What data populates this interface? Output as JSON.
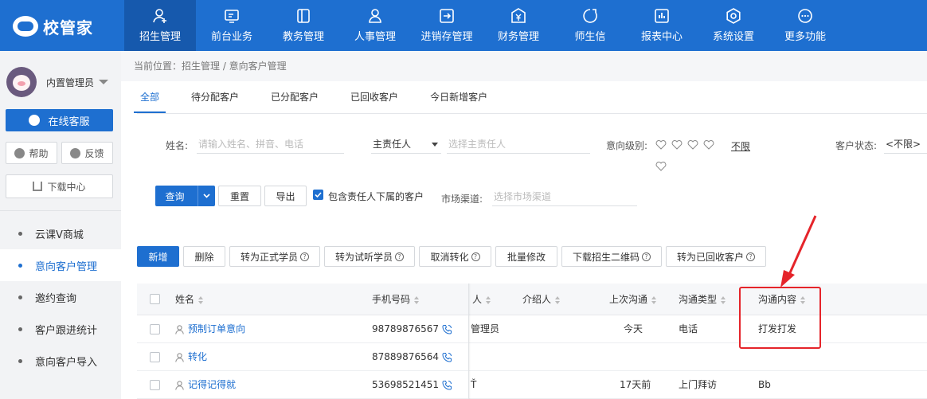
{
  "app": {
    "logo_text": "校管家"
  },
  "nav": [
    {
      "label": "招生管理",
      "icon": "user-add-icon"
    },
    {
      "label": "前台业务",
      "icon": "monitor-icon"
    },
    {
      "label": "教务管理",
      "icon": "book-icon"
    },
    {
      "label": "人事管理",
      "icon": "person-icon"
    },
    {
      "label": "进销存管理",
      "icon": "inventory-icon"
    },
    {
      "label": "财务管理",
      "icon": "yen-icon"
    },
    {
      "label": "师生信",
      "icon": "chat-icon"
    },
    {
      "label": "报表中心",
      "icon": "chart-icon"
    },
    {
      "label": "系统设置",
      "icon": "settings-icon"
    },
    {
      "label": "更多功能",
      "icon": "more-icon"
    }
  ],
  "sidebar": {
    "username": "内置管理员",
    "online_service": "在线客服",
    "help": "帮助",
    "feedback": "反馈",
    "download_center": "下载中心",
    "menu": [
      {
        "label": "云课V商城"
      },
      {
        "label": "意向客户管理"
      },
      {
        "label": "邀约查询"
      },
      {
        "label": "客户跟进统计"
      },
      {
        "label": "意向客户导入"
      }
    ]
  },
  "breadcrumb": "当前位置：招生管理 / 意向客户管理",
  "tabs": [
    "全部",
    "待分配客户",
    "已分配客户",
    "已回收客户",
    "今日新增客户"
  ],
  "filters": {
    "name_label": "姓名:",
    "name_placeholder": "请输入姓名、拼音、电话",
    "owner_select": "主责任人",
    "owner_placeholder": "选择主责任人",
    "intent_label": "意向级别:",
    "intent_unlimited": "不限",
    "status_label": "客户状态:",
    "status_value": "<不限>",
    "channel_label": "市场渠道:",
    "channel_placeholder": "选择市场渠道",
    "include_sub_label": "包含责任人下属的客户"
  },
  "buttons": {
    "query": "查询",
    "reset": "重置",
    "export": "导出"
  },
  "actions": {
    "add": "新增",
    "delete": "删除",
    "to_formal": "转为正式学员",
    "to_trial": "转为试听学员",
    "cancel_convert": "取消转化",
    "batch_edit": "批量修改",
    "download_qr": "下载招生二维码",
    "to_recycled": "转为已回收客户"
  },
  "table": {
    "headers": {
      "name": "姓名",
      "phone": "手机号码",
      "owner_partial": "人",
      "referrer": "介绍人",
      "last_contact": "上次沟通",
      "contact_type": "沟通类型",
      "contact_content": "沟通内容"
    },
    "rows": [
      {
        "name": "预制订单意向",
        "phone": "98789876567",
        "owner_partial": "管理员",
        "referrer": "",
        "last_contact": "今天",
        "contact_type": "电话",
        "contact_content": "打发打发"
      },
      {
        "name": "转化",
        "phone": "87889876564",
        "owner_partial": "",
        "referrer": "",
        "last_contact": "",
        "contact_type": "",
        "contact_content": ""
      },
      {
        "name": "记得记得就",
        "phone": "53698521451",
        "owner_partial": "Ť",
        "referrer": "",
        "last_contact": "17天前",
        "contact_type": "上门拜访",
        "contact_content": "Bb"
      }
    ]
  },
  "colors": {
    "primary": "#1e6fd0",
    "nav_active": "#1659ad",
    "annotation": "#e5242a"
  }
}
